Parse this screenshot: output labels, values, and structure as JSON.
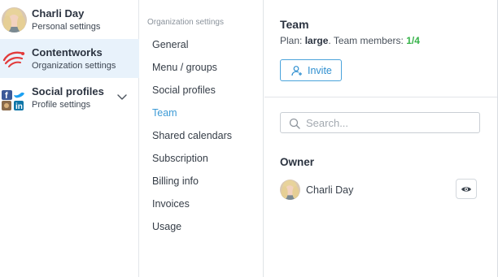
{
  "accounts": [
    {
      "name": "Charli Day",
      "subtitle": "Personal settings",
      "avatar": "user-photo",
      "active": false
    },
    {
      "name": "Contentworks",
      "subtitle": "Organization settings",
      "avatar": "contentworks-logo",
      "active": true
    },
    {
      "name": "Social profiles",
      "subtitle": "Profile settings",
      "avatar": "social-network-icons",
      "active": false
    }
  ],
  "menu": {
    "heading": "Organization settings",
    "items": [
      {
        "label": "General"
      },
      {
        "label": "Menu / groups"
      },
      {
        "label": "Social profiles"
      },
      {
        "label": "Team",
        "active": true
      },
      {
        "label": "Shared calendars"
      },
      {
        "label": "Subscription"
      },
      {
        "label": "Billing info"
      },
      {
        "label": "Invoices"
      },
      {
        "label": "Usage"
      }
    ]
  },
  "team": {
    "title": "Team",
    "plan_prefix": "Plan: ",
    "plan_name": "large",
    "members_prefix": ". Team members: ",
    "members_ratio": "1/4",
    "invite_label": "Invite",
    "search_placeholder": "Search...",
    "owner_heading": "Owner",
    "owner_name": "Charli Day"
  },
  "colors": {
    "accent": "#3d9bd6",
    "active_bg": "#e8f2fb",
    "ratio_green": "#37b34a"
  }
}
